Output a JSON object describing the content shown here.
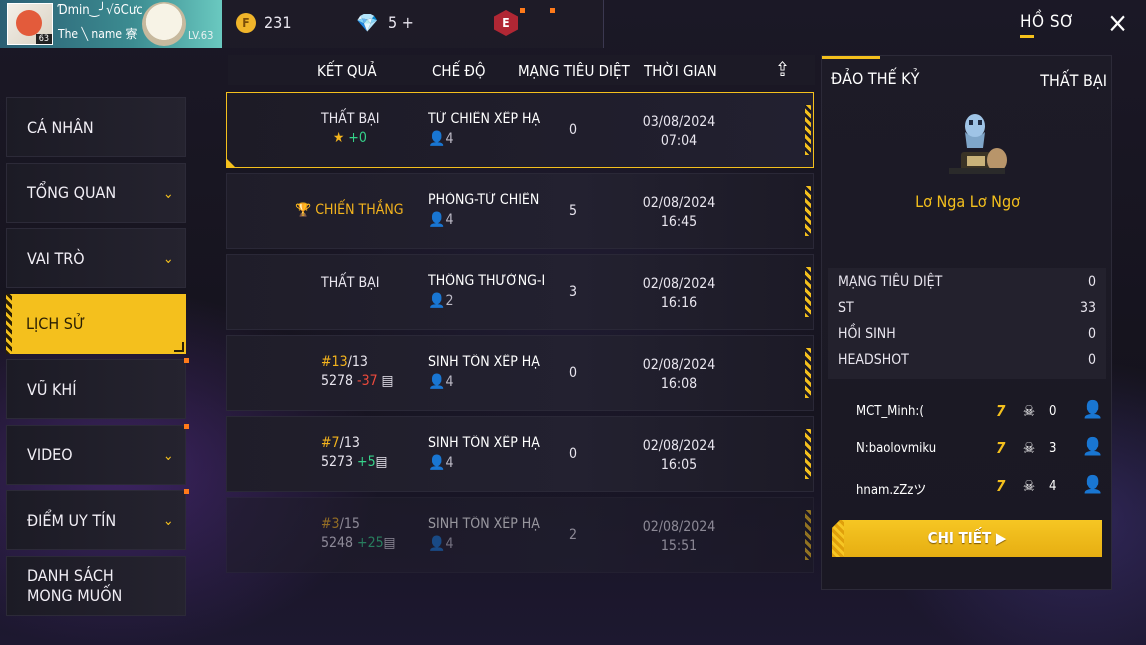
{
  "topbar": {
    "player_name": "Ɗmin‿╯√ōCưc",
    "guild_tag": "The ╲ name ‌寮",
    "avatar_level": "63",
    "level_label": "LV.63",
    "gold": "231",
    "diamonds": "5",
    "diamonds_plus": "+",
    "rank_badge": "E",
    "page_title": "HỒ SƠ",
    "close_icon": "×"
  },
  "sidebar": {
    "items": [
      {
        "label": "CÁ NHÂN"
      },
      {
        "label": "TỔNG QUAN"
      },
      {
        "label": "VAI TRÒ"
      },
      {
        "label": "LỊCH SỬ"
      },
      {
        "label": "VŨ KHÍ"
      },
      {
        "label": "VIDEO"
      },
      {
        "label": "ĐIỂM UY TÍN"
      },
      {
        "label": "DANH SÁCH MONG MUỐN"
      }
    ],
    "active": "LỊCH SỬ"
  },
  "table": {
    "headers": {
      "result": "KẾT QUẢ",
      "mode": "CHẾ ĐỘ",
      "kills": "MẠNG TIÊU DIỆT",
      "time": "THỜI GIAN"
    },
    "rows": [
      {
        "result": "THẤT BẠI",
        "sub_star": "★",
        "sub_delta": "+0",
        "mode": "TỬ CHIẾN XẾP HẠ",
        "players": "4",
        "kills": "0",
        "date": "03/08/2024",
        "time": "07:04"
      },
      {
        "result_icon": "🏆",
        "result": "CHIẾN THẮNG",
        "mode": "PHÒNG-TỬ CHIẾN",
        "players": "4",
        "kills": "5",
        "date": "02/08/2024",
        "time": "16:45"
      },
      {
        "result": "THẤT BẠI",
        "mode": "THÔNG THƯỜNG-I",
        "players": "2",
        "kills": "3",
        "date": "02/08/2024",
        "time": "16:16"
      },
      {
        "rank": "#13",
        "rank_total": "/13",
        "score": "5278",
        "delta": "-37",
        "mode": "SINH TỒN XẾP HẠ",
        "players": "4",
        "kills": "0",
        "date": "02/08/2024",
        "time": "16:08"
      },
      {
        "rank": "#7",
        "rank_total": "/13",
        "score": "5273",
        "delta": "+5",
        "mode": "SINH TỒN XẾP HẠ",
        "players": "4",
        "kills": "0",
        "date": "02/08/2024",
        "time": "16:05"
      },
      {
        "rank": "#3",
        "rank_total": "/15",
        "score": "5248",
        "delta": "+25",
        "mode": "SINH TỒN XẾP HẠ",
        "players": "4",
        "kills": "2",
        "date": "02/08/2024",
        "time": "15:51"
      }
    ]
  },
  "detail": {
    "map": "ĐẢO THẾ KỶ",
    "result": "THẤT BẠI",
    "character": "Lơ Nga Lơ Ngơ",
    "stats": [
      {
        "label": "MẠNG TIÊU DIỆT",
        "value": "0"
      },
      {
        "label": "ST",
        "value": "33"
      },
      {
        "label": "HỒI SINH",
        "value": "0"
      },
      {
        "label": "HEADSHOT",
        "value": "0"
      }
    ],
    "team": [
      {
        "name": "MCT_Minh:(",
        "kills": "0"
      },
      {
        "name": "N:baolovmiku",
        "kills": "3"
      },
      {
        "name": "hnam.zZzツ",
        "kills": "4"
      }
    ],
    "button": "CHI TIẾT ▶"
  },
  "colors": {
    "accent": "#f4c01d",
    "win": "#f4b41d",
    "positive": "#35d28a",
    "negative": "#ee4a3c"
  }
}
